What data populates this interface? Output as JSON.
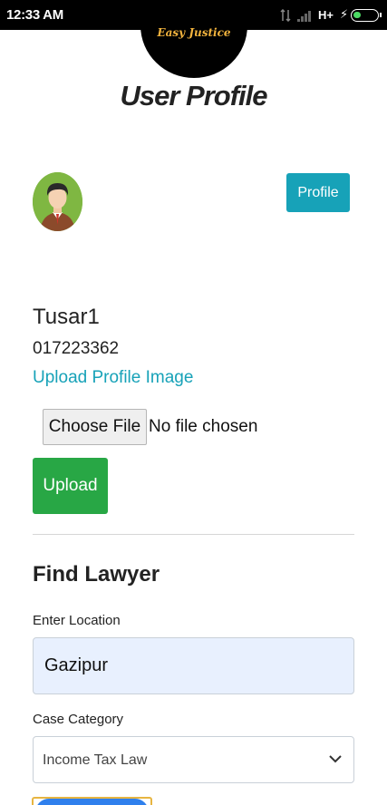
{
  "status_bar": {
    "time": "12:33 AM",
    "network": "H+",
    "icons": [
      "data-arrows-icon",
      "signal-icon",
      "charging-bolt-icon",
      "battery-icon"
    ],
    "battery_color": "#4cd964"
  },
  "logo": {
    "text": "Easy Justice"
  },
  "page": {
    "title": "User Profile"
  },
  "profile": {
    "button_label": "Profile",
    "name": "Tusar1",
    "phone": "017223362",
    "upload_link": "Upload Profile Image",
    "file_button": "Choose File",
    "file_status": "No file chosen",
    "upload_button": "Upload"
  },
  "find_lawyer": {
    "title": "Find Lawyer",
    "location_label": "Enter Location",
    "location_value": "Gazipur",
    "category_label": "Case Category",
    "category_value": "Income Tax Law"
  },
  "colors": {
    "info": "#17a2b8",
    "success": "#28a745",
    "autofill": "#e8f0fe",
    "logo_text": "#f2b33d"
  }
}
